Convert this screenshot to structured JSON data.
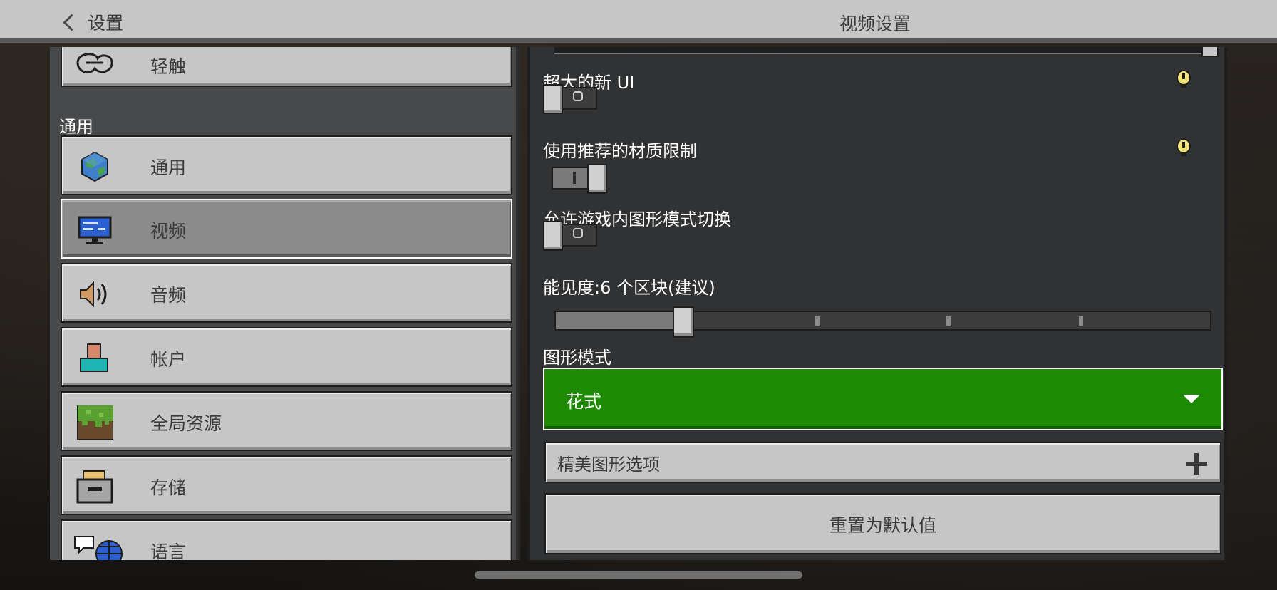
{
  "header": {
    "back_label": "设置",
    "title": "视频设置"
  },
  "sidebar": {
    "partial_top_item": "轻触",
    "section_label": "通用",
    "items": [
      {
        "label": "通用",
        "icon": "globe-icon",
        "selected": false
      },
      {
        "label": "视频",
        "icon": "monitor-icon",
        "selected": true
      },
      {
        "label": "音频",
        "icon": "speaker-icon",
        "selected": false
      },
      {
        "label": "帐户",
        "icon": "account-icon",
        "selected": false
      },
      {
        "label": "全局资源",
        "icon": "grass-block-icon",
        "selected": false
      },
      {
        "label": "存储",
        "icon": "storage-icon",
        "selected": false
      },
      {
        "label": "语言",
        "icon": "language-icon",
        "selected": false
      }
    ]
  },
  "settings": {
    "large_ui": {
      "label": "超大的新 UI",
      "enabled": false
    },
    "texture_limit": {
      "label": "使用推荐的材质限制",
      "enabled": true
    },
    "ingame_graphics_switch": {
      "label": "允许游戏内图形模式切换",
      "enabled": false
    },
    "render_distance": {
      "label": "能见度:6 个区块(建议)",
      "value": 6,
      "fraction": 0.18
    },
    "graphics_mode": {
      "label": "图形模式",
      "value": "花式"
    },
    "fancy_options": {
      "label": "精美图形选项"
    },
    "reset": {
      "label": "重置为默认值"
    }
  },
  "colors": {
    "panel_light": "#c6c6c6",
    "panel_dark": "#313233",
    "accent_green": "#1e8a04",
    "info_yellow": "#f2e27a"
  }
}
